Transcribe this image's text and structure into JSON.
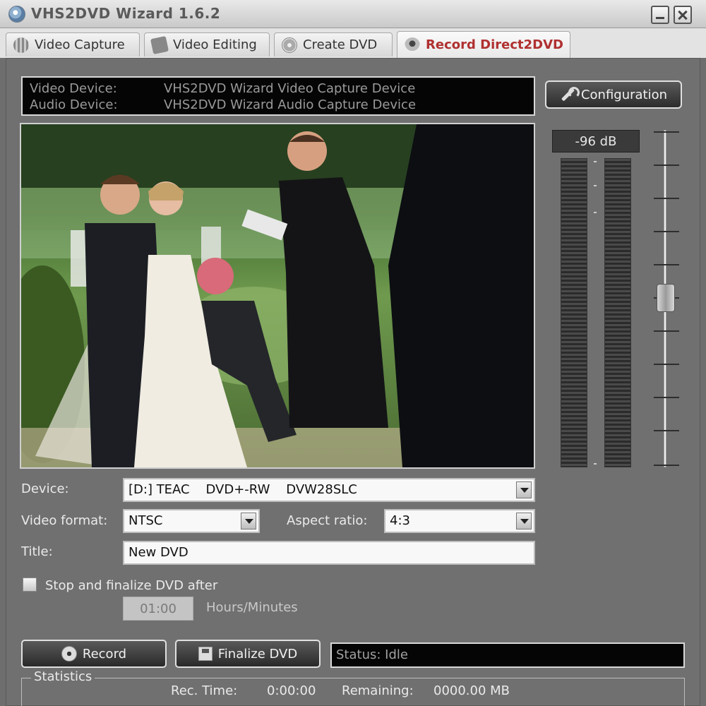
{
  "window": {
    "title": "VHS2DVD Wizard 1.6.2"
  },
  "tabs": [
    {
      "label": "Video Capture",
      "icon": "film-reel-icon"
    },
    {
      "label": "Video Editing",
      "icon": "edit-icon"
    },
    {
      "label": "Create DVD",
      "icon": "disc-icon"
    },
    {
      "label": "Record Direct2DVD",
      "icon": "webcam-icon",
      "active": true
    }
  ],
  "devices": {
    "video_label": "Video Device:",
    "video_value": "VHS2DVD Wizard Video Capture Device",
    "audio_label": "Audio Device:",
    "audio_value": "VHS2DVD Wizard Audio Capture Device"
  },
  "config_button": "Configuration",
  "audio": {
    "level": "-96 dB"
  },
  "form": {
    "device_label": "Device:",
    "device_value": "[D:] TEAC    DVD+-RW    DVW28SLC",
    "format_label": "Video format:",
    "format_value": "NTSC",
    "aspect_label": "Aspect ratio:",
    "aspect_value": "4:3",
    "title_label": "Title:",
    "title_value": "New DVD",
    "stop_label": "Stop and finalize DVD after",
    "time_value": "01:00",
    "time_unit": "Hours/Minutes"
  },
  "buttons": {
    "record": "Record",
    "finalize": "Finalize DVD"
  },
  "status": "Status: Idle",
  "statistics": {
    "title": "Statistics",
    "rec_time_label": "Rec. Time:",
    "rec_time_value": "0:00:00",
    "remaining_label": "Remaining:",
    "remaining_value": "0000.00 MB"
  },
  "colors": {
    "active_tab": "#b03030",
    "panel": "#707070",
    "display_bg": "#050505"
  }
}
